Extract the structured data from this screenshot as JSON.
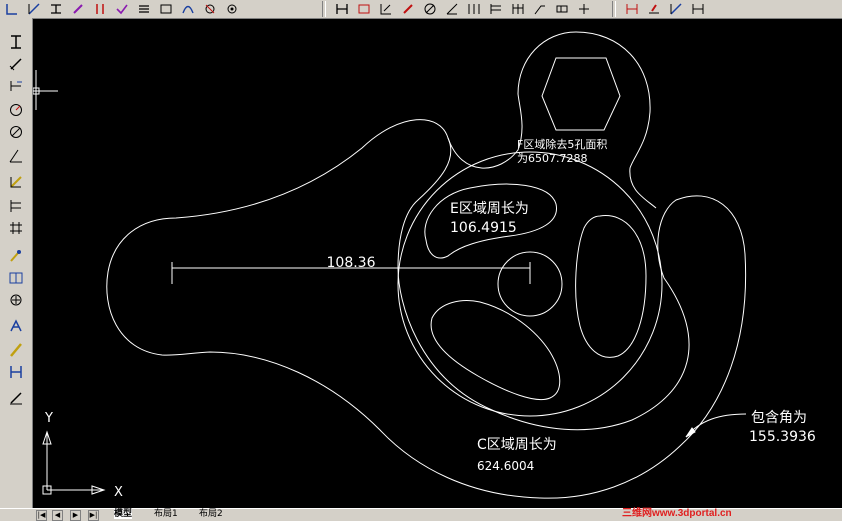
{
  "drawing": {
    "dimension_value": "108.36",
    "region_f_label_line1": "F区域除去5孔面积",
    "region_f_label_line2": "为6507.7288",
    "region_e_label_line1": "E区域周长为",
    "region_e_label_line2": "106.4915",
    "region_c_label_line1": "C区域周长为",
    "region_c_label_line2": "624.6004",
    "angle_label_line1": "包含角为",
    "angle_label_line2": "155.3936",
    "ucs_x_label": "X",
    "ucs_y_label": "Y"
  },
  "colors": {
    "canvas_background": "#000000",
    "geometry": "#ffffff",
    "watermark": "#e02020"
  },
  "layout_tabs": {
    "nav_first": "|◀",
    "nav_prev": "◀",
    "nav_next": "▶",
    "nav_last": "▶|",
    "model": "模型",
    "layout1": "布局1",
    "layout2": "布局2"
  },
  "watermark": "三维网www.3dportal.cn",
  "toolbar_icons": {
    "top": [
      "line-icon",
      "ucs-icon",
      "dimension-icon",
      "pen-icon",
      "parallel-icon",
      "check-icon",
      "stack-icon",
      "tolerance-icon",
      "spline-icon",
      "snap-icon",
      "settings-icon",
      "linear-dim-icon",
      "aligned-dim-icon",
      "ordinate-dim-icon",
      "radius-dim-icon",
      "diameter-dim-icon",
      "angular-dim-icon",
      "quick-dim-icon",
      "baseline-dim-icon",
      "continue-dim-icon",
      "leader-icon",
      "tolerance-frame-icon",
      "center-mark-icon",
      "dim-edit-icon",
      "dim-text-edit-icon",
      "dim-update-icon",
      "dim-style-icon"
    ],
    "left": [
      "linear-dim-icon",
      "aligned-dim-icon",
      "ordinate-dim-icon",
      "radius-dim-icon",
      "diameter-dim-icon",
      "angular-dim-icon",
      "quick-dim-icon",
      "baseline-dim-icon",
      "continue-dim-icon",
      "leader-icon",
      "tolerance-icon",
      "center-mark-icon",
      "dim-edit-icon",
      "dim-text-edit-icon",
      "dim-update-icon",
      "dim-style-icon"
    ]
  }
}
